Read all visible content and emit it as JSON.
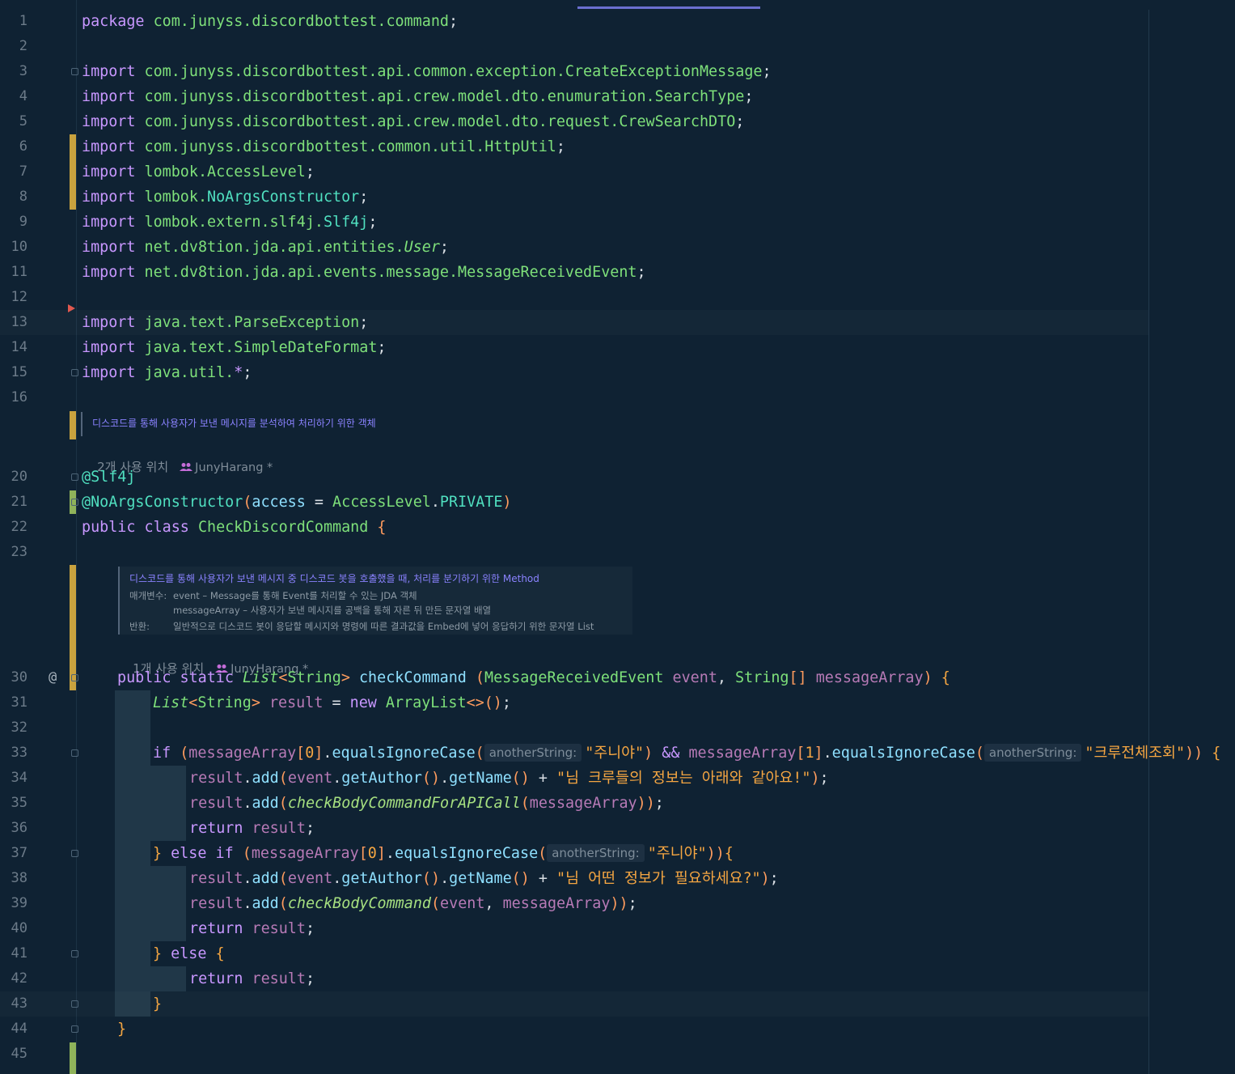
{
  "editor": {
    "lines": [
      {
        "n": "1",
        "tokens": [
          [
            "kw",
            "package "
          ],
          [
            "pk",
            "com.junyss.discordbottest.command"
          ],
          [
            "pu",
            ";"
          ]
        ]
      },
      {
        "n": "2",
        "tokens": []
      },
      {
        "n": "3",
        "tokens": [
          [
            "kw",
            "import "
          ],
          [
            "pk",
            "com.junyss.discordbottest.api.common.exception.CreateExceptionMessage"
          ],
          [
            "pu",
            ";"
          ]
        ]
      },
      {
        "n": "4",
        "tokens": [
          [
            "kw",
            "import "
          ],
          [
            "pk",
            "com.junyss.discordbottest.api.crew.model.dto.enumuration.SearchType"
          ],
          [
            "pu",
            ";"
          ]
        ]
      },
      {
        "n": "5",
        "tokens": [
          [
            "kw",
            "import "
          ],
          [
            "pk",
            "com.junyss.discordbottest.api.crew.model.dto.request.CrewSearchDTO"
          ],
          [
            "pu",
            ";"
          ]
        ]
      },
      {
        "n": "6",
        "tokens": [
          [
            "kw",
            "import "
          ],
          [
            "pk",
            "com.junyss.discordbottest.common.util.HttpUtil"
          ],
          [
            "pu",
            ";"
          ]
        ]
      },
      {
        "n": "7",
        "tokens": [
          [
            "kw",
            "import "
          ],
          [
            "pk",
            "lombok.AccessLevel"
          ],
          [
            "pu",
            ";"
          ]
        ]
      },
      {
        "n": "8",
        "tokens": [
          [
            "kw",
            "import "
          ],
          [
            "pk",
            "lombok."
          ],
          [
            "an",
            "NoArgsConstructor"
          ],
          [
            "pu",
            ";"
          ]
        ]
      },
      {
        "n": "9",
        "tokens": [
          [
            "kw",
            "import "
          ],
          [
            "pk",
            "lombok.extern.slf4j."
          ],
          [
            "an",
            "Slf4j"
          ],
          [
            "pu",
            ";"
          ]
        ]
      },
      {
        "n": "10",
        "tokens": [
          [
            "kw",
            "import "
          ],
          [
            "pk",
            "net.dv8tion.jda.api.entities."
          ],
          [
            "tyi",
            "User"
          ],
          [
            "pu",
            ";"
          ]
        ]
      },
      {
        "n": "11",
        "tokens": [
          [
            "kw",
            "import "
          ],
          [
            "pk",
            "net.dv8tion.jda.api.events.message.MessageReceivedEvent"
          ],
          [
            "pu",
            ";"
          ]
        ]
      },
      {
        "n": "12",
        "tokens": []
      },
      {
        "n": "13",
        "tokens": [
          [
            "kw",
            "import "
          ],
          [
            "pk",
            "java.text.ParseException"
          ],
          [
            "pu",
            ";"
          ]
        ]
      },
      {
        "n": "14",
        "tokens": [
          [
            "kw",
            "import "
          ],
          [
            "pk",
            "java.text.SimpleDateFormat"
          ],
          [
            "pu",
            ";"
          ]
        ]
      },
      {
        "n": "15",
        "tokens": [
          [
            "kw",
            "import "
          ],
          [
            "pk",
            "java.util."
          ],
          [
            "op",
            "*"
          ],
          [
            "pu",
            ";"
          ]
        ]
      },
      {
        "n": "16",
        "tokens": []
      },
      {
        "n": "20",
        "tokens": [
          [
            "an",
            "@Slf4j"
          ]
        ]
      },
      {
        "n": "21",
        "tokens": [
          [
            "an",
            "@NoArgsConstructor"
          ],
          [
            "pr",
            "("
          ],
          [
            "fn",
            "access"
          ],
          [
            "pu",
            " = "
          ],
          [
            "cl",
            "AccessLevel"
          ],
          [
            "pu",
            "."
          ],
          [
            "an",
            "PRIVATE"
          ],
          [
            "pr",
            ")"
          ]
        ]
      },
      {
        "n": "22",
        "tokens": [
          [
            "kw",
            "public class "
          ],
          [
            "cl",
            "CheckDiscordCommand"
          ],
          [
            "pu",
            " "
          ],
          [
            "pr",
            "{"
          ]
        ]
      },
      {
        "n": "23",
        "tokens": []
      },
      {
        "n": "30",
        "tokens": [
          [
            "kw",
            "public static "
          ],
          [
            "tyi",
            "List"
          ],
          [
            "pr",
            "<"
          ],
          [
            "ty",
            "String"
          ],
          [
            "pr",
            ">"
          ],
          [
            "pu",
            " "
          ],
          [
            "fn",
            "checkCommand "
          ],
          [
            "pr",
            "("
          ],
          [
            "ty",
            "MessageReceivedEvent"
          ],
          [
            "var",
            " event"
          ],
          [
            "pu",
            ", "
          ],
          [
            "ty",
            "String"
          ],
          [
            "pr",
            "[]"
          ],
          [
            "var",
            " messageArray"
          ],
          [
            "pr",
            ")"
          ],
          [
            "pu",
            " "
          ],
          [
            "str",
            "{"
          ]
        ]
      },
      {
        "n": "31",
        "tokens": [
          [
            "tyi",
            "List"
          ],
          [
            "pr",
            "<"
          ],
          [
            "ty",
            "String"
          ],
          [
            "pr",
            ">"
          ],
          [
            "var",
            " result"
          ],
          [
            "pu",
            " = "
          ],
          [
            "kw",
            "new "
          ],
          [
            "ty",
            "ArrayList"
          ],
          [
            "pr",
            "<>()"
          ],
          [
            "pu",
            ";"
          ]
        ]
      },
      {
        "n": "32",
        "tokens": []
      },
      {
        "n": "33",
        "tokens": [
          [
            "kw",
            "if "
          ],
          [
            "pr",
            "("
          ],
          [
            "var",
            "messageArray"
          ],
          [
            "pr",
            "["
          ],
          [
            "str",
            "0"
          ],
          [
            "pr",
            "]"
          ],
          [
            "pu",
            "."
          ],
          [
            "fn",
            "equalsIgnoreCase"
          ],
          [
            "pr",
            "("
          ],
          [
            "hint",
            "anotherString:"
          ],
          [
            "str",
            "\"주니야\""
          ],
          [
            "pr",
            ")"
          ],
          [
            "op",
            " && "
          ],
          [
            "var",
            "messageArray"
          ],
          [
            "pr",
            "["
          ],
          [
            "str",
            "1"
          ],
          [
            "pr",
            "]"
          ],
          [
            "pu",
            "."
          ],
          [
            "fn",
            "equalsIgnoreCase"
          ],
          [
            "pr",
            "("
          ],
          [
            "hint",
            "anotherString:"
          ],
          [
            "str",
            "\"크루전체조회\""
          ],
          [
            "pr",
            "))"
          ],
          [
            "pu",
            " "
          ],
          [
            "str",
            "{"
          ]
        ]
      },
      {
        "n": "34",
        "tokens": [
          [
            "var",
            "result"
          ],
          [
            "pu",
            "."
          ],
          [
            "fn",
            "add"
          ],
          [
            "pr",
            "("
          ],
          [
            "var",
            "event"
          ],
          [
            "pu",
            "."
          ],
          [
            "fn",
            "getAuthor"
          ],
          [
            "pr",
            "()"
          ],
          [
            "pu",
            "."
          ],
          [
            "fn",
            "getName"
          ],
          [
            "pr",
            "()"
          ],
          [
            "pu",
            " + "
          ],
          [
            "str",
            "\"님 크루들의 정보는 아래와 같아요!\""
          ],
          [
            "pr",
            ")"
          ],
          [
            "pu",
            ";"
          ]
        ]
      },
      {
        "n": "35",
        "tokens": [
          [
            "var",
            "result"
          ],
          [
            "pu",
            "."
          ],
          [
            "fn",
            "add"
          ],
          [
            "pr",
            "("
          ],
          [
            "fni",
            "checkBodyCommandForAPICall"
          ],
          [
            "pr",
            "("
          ],
          [
            "var",
            "messageArray"
          ],
          [
            "pr",
            "))"
          ],
          [
            "pu",
            ";"
          ]
        ]
      },
      {
        "n": "36",
        "tokens": [
          [
            "kw",
            "return "
          ],
          [
            "var",
            "result"
          ],
          [
            "pu",
            ";"
          ]
        ]
      },
      {
        "n": "37",
        "tokens": [
          [
            "str",
            "}"
          ],
          [
            "kw",
            " else if "
          ],
          [
            "pr",
            "("
          ],
          [
            "var",
            "messageArray"
          ],
          [
            "pr",
            "["
          ],
          [
            "str",
            "0"
          ],
          [
            "pr",
            "]"
          ],
          [
            "pu",
            "."
          ],
          [
            "fn",
            "equalsIgnoreCase"
          ],
          [
            "pr",
            "("
          ],
          [
            "hint",
            "anotherString:"
          ],
          [
            "str",
            "\"주니야\""
          ],
          [
            "pr",
            "))"
          ],
          [
            "str",
            "{"
          ]
        ]
      },
      {
        "n": "38",
        "tokens": [
          [
            "var",
            "result"
          ],
          [
            "pu",
            "."
          ],
          [
            "fn",
            "add"
          ],
          [
            "pr",
            "("
          ],
          [
            "var",
            "event"
          ],
          [
            "pu",
            "."
          ],
          [
            "fn",
            "getAuthor"
          ],
          [
            "pr",
            "()"
          ],
          [
            "pu",
            "."
          ],
          [
            "fn",
            "getName"
          ],
          [
            "pr",
            "()"
          ],
          [
            "pu",
            " + "
          ],
          [
            "str",
            "\"님 어떤 정보가 필요하세요?\""
          ],
          [
            "pr",
            ")"
          ],
          [
            "pu",
            ";"
          ]
        ]
      },
      {
        "n": "39",
        "tokens": [
          [
            "var",
            "result"
          ],
          [
            "pu",
            "."
          ],
          [
            "fn",
            "add"
          ],
          [
            "pr",
            "("
          ],
          [
            "fni",
            "checkBodyCommand"
          ],
          [
            "pr",
            "("
          ],
          [
            "var",
            "event"
          ],
          [
            "pu",
            ", "
          ],
          [
            "var",
            "messageArray"
          ],
          [
            "pr",
            "))"
          ],
          [
            "pu",
            ";"
          ]
        ]
      },
      {
        "n": "40",
        "tokens": [
          [
            "kw",
            "return "
          ],
          [
            "var",
            "result"
          ],
          [
            "pu",
            ";"
          ]
        ]
      },
      {
        "n": "41",
        "tokens": [
          [
            "str",
            "}"
          ],
          [
            "kw",
            " else "
          ],
          [
            "str",
            "{"
          ]
        ]
      },
      {
        "n": "42",
        "tokens": [
          [
            "kw",
            "return "
          ],
          [
            "var",
            "result"
          ],
          [
            "pu",
            ";"
          ]
        ]
      },
      {
        "n": "43",
        "tokens": [
          [
            "str",
            "}"
          ]
        ]
      },
      {
        "n": "44",
        "tokens": [
          [
            "str",
            "}"
          ]
        ]
      },
      {
        "n": "45",
        "tokens": []
      }
    ]
  },
  "class_doc": {
    "text": "디스코드를 통해 사용자가 보낸 메시지를 분석하여 처리하기 위한 객체"
  },
  "class_usage": {
    "count": "2개 사용 위치",
    "author": "JunyHarang *"
  },
  "method_doc": {
    "title": "디스코드를 통해 사용자가 보낸 메시지 중 디스코드 봇을 호출했을 때, 처리를 분기하기 위한 Method",
    "params_label": "매개변수:",
    "param1": "event – Message를 통해 Event를 처리할 수 있는 JDA 객체",
    "param2": "messageArray – 사용자가 보낸 메시지를 공백을 통해 자른 뒤 만든 문자열 배열",
    "returns_label": "반환:",
    "returns": "일반적으로 디스코드 봇이 응답할 메시지와 명령에 따른 결과값을 Embed에 넣어 응답하기 위한 문자열 List"
  },
  "method_usage": {
    "count": "1개 사용 위치",
    "author": "JunyHarang *"
  },
  "gutter": {
    "override_marker": "@"
  },
  "theme": {
    "background": "#0f2233",
    "keyword": "#c897ff",
    "class": "#7ee07a",
    "string": "#f5a642",
    "variable": "#b77ab6",
    "method": "#8fe0ff",
    "annotation": "#50e0c0",
    "vcs_modified": "#c9a23e",
    "vcs_added": "#8fb35a"
  }
}
